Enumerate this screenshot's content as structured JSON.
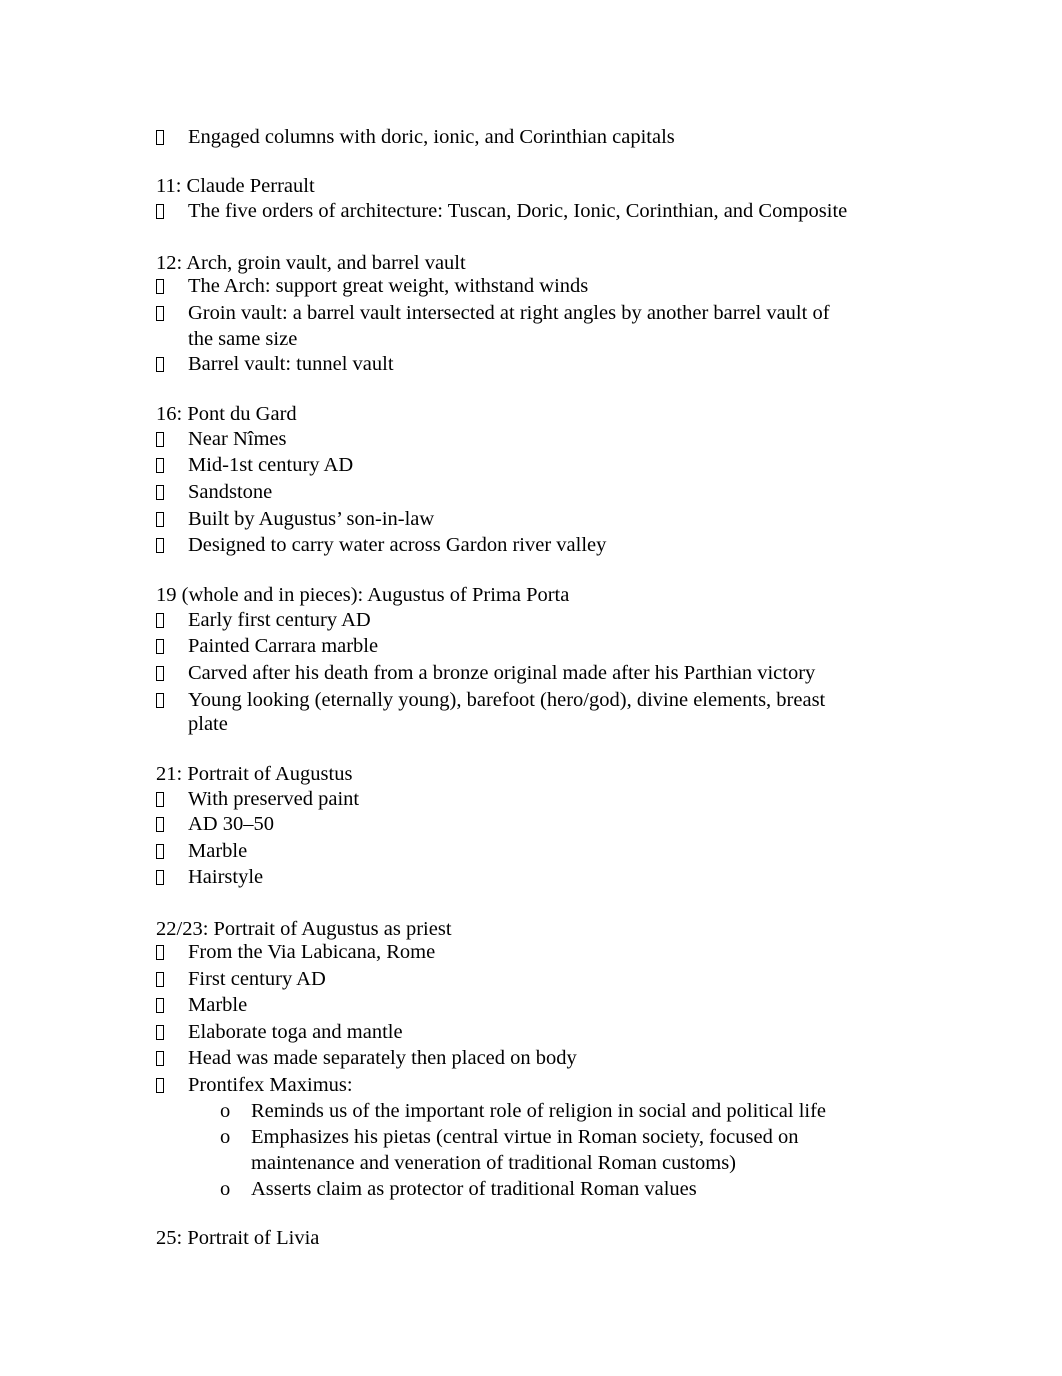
{
  "document": {
    "sections": [
      {
        "heading": null,
        "bullets": [
          {
            "text": "Engaged columns with doric, ionic, and Corinthian capitals"
          }
        ]
      },
      {
        "heading": "11: Claude Perrault",
        "bullets": [
          {
            "text": "The five orders of architecture: Tuscan, Doric, Ionic, Corinthian, and Composite"
          }
        ]
      },
      {
        "heading": "12: Arch, groin vault, and barrel vault",
        "bullets": [
          {
            "text": "The Arch: support great weight, withstand winds"
          },
          {
            "text": "Groin vault: a barrel vault intersected at right angles by another barrel vault of",
            "continuation": "the same size"
          },
          {
            "text": "Barrel vault: tunnel vault"
          }
        ]
      },
      {
        "heading": "16: Pont du Gard",
        "bullets": [
          {
            "text": "Near Nîmes"
          },
          {
            "text": "Mid-1st century AD"
          },
          {
            "text": "Sandstone"
          },
          {
            "text": "Built by Augustus’ son-in-law"
          },
          {
            "text": "Designed to carry water across Gardon river valley"
          }
        ]
      },
      {
        "heading": "19 (whole and in pieces): Augustus of Prima Porta",
        "bullets": [
          {
            "text": "Early first century AD"
          },
          {
            "text": "Painted Carrara marble"
          },
          {
            "text": "Carved after his death from a bronze original made after his Parthian victory"
          },
          {
            "text": "Young looking (eternally young), barefoot (hero/god), divine elements, breast",
            "continuation": "plate"
          }
        ]
      },
      {
        "heading": "21: Portrait of Augustus",
        "bullets": [
          {
            "text": "With preserved paint"
          },
          {
            "text": "AD 30–50"
          },
          {
            "text": "Marble"
          },
          {
            "text": "Hairstyle"
          }
        ]
      },
      {
        "heading": "22/23: Portrait of Augustus as priest",
        "bullets": [
          {
            "text": "From the Via Labicana, Rome"
          },
          {
            "text": "First century AD"
          },
          {
            "text": "Marble"
          },
          {
            "text": "Elaborate toga and mantle"
          },
          {
            "text": "Head was made separately then placed on body"
          },
          {
            "text": "Prontifex Maximus:"
          }
        ],
        "sub_bullets": [
          {
            "marker": "o",
            "text": "Reminds us of the important role of religion in social and political life"
          },
          {
            "marker": "o",
            "text": "Emphasizes his pietas (central virtue in Roman society, focused on",
            "continuation": "maintenance and veneration of traditional Roman customs)"
          },
          {
            "marker": "o",
            "text": "Asserts claim as protector of traditional Roman values"
          }
        ]
      },
      {
        "heading": "25: Portrait of Livia",
        "bullets": []
      }
    ]
  }
}
